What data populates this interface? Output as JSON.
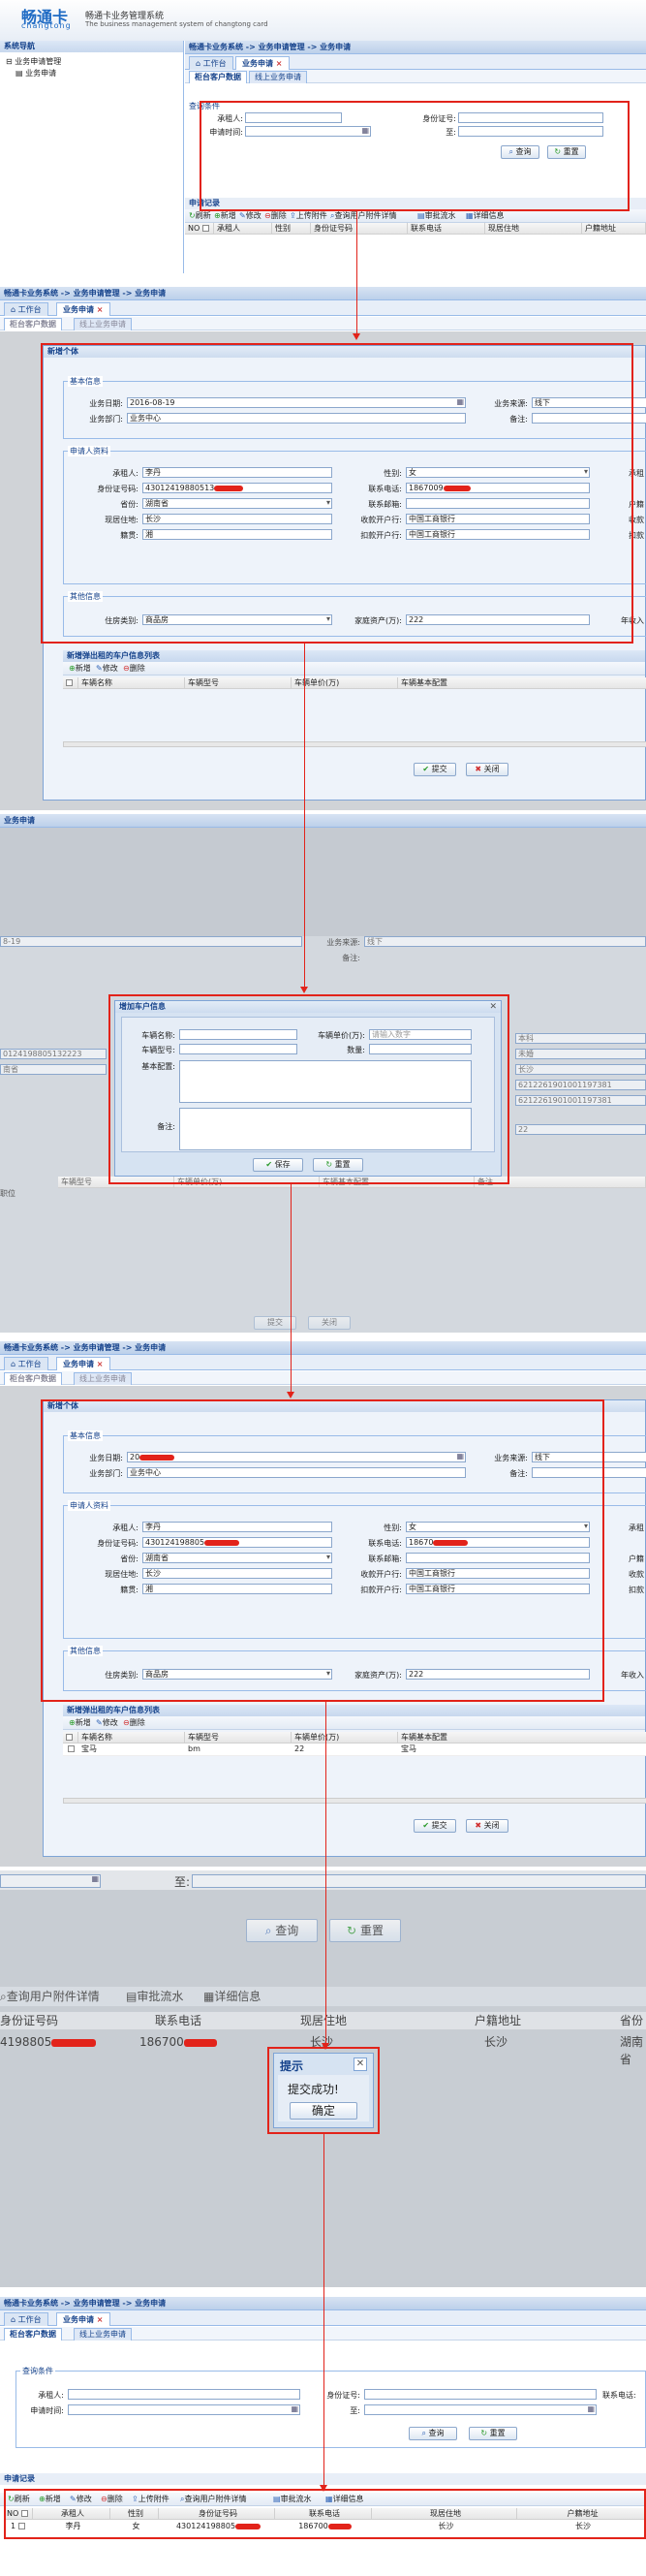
{
  "app": {
    "logo": "畅通卡",
    "logo_en": "changtong",
    "system_title": "畅通卡业务管理系统",
    "system_en": "The business management system of changtong card"
  },
  "nav": {
    "title": "系统导航",
    "group": "业务申请管理",
    "item": "业务申请"
  },
  "breadcrumb": "畅通卡业务系统 -> 业务申请管理 -> 业务申请",
  "breadcrumb_short": "业务申请",
  "tabs": {
    "workbench": "工作台",
    "apply": "业务申请",
    "close": "×"
  },
  "subtabs": {
    "counter": "柜台客户数据",
    "online": "线上业务申请"
  },
  "query": {
    "legend": "查询条件",
    "applicant": "承租人:",
    "idno": "身份证号:",
    "phone": "联系电话:",
    "apply_time": "申请时间:",
    "to": "至:",
    "search": "查询",
    "reset": "重置"
  },
  "records": {
    "title": "申请记录",
    "toolbar": [
      "刷新",
      "新增",
      "修改",
      "删除",
      "上传附件",
      "查询用户附件详情",
      "审批流水",
      "详细信息"
    ],
    "toolbar_short": [
      "查询用户附件详情",
      "审批流水",
      "详细信息"
    ],
    "columns": [
      "NO",
      "承租人",
      "性别",
      "身份证号码",
      "联系电话",
      "现居住地",
      "户籍地址"
    ],
    "columns_zoom": [
      "身份证号码",
      "联系电话",
      "现居住地",
      "户籍地址",
      "省份"
    ],
    "row": {
      "no": "1",
      "name": "李丹",
      "sex": "女",
      "id": "430124198805",
      "phone": "186700",
      "addr": "长沙",
      "reg": "长沙",
      "prov": "湖南省"
    },
    "zoom_row": {
      "id": "4198805",
      "phone": "186700",
      "addr": "长沙",
      "reg": "长沙",
      "prov": "湖南省"
    }
  },
  "form": {
    "title": "新增个体",
    "basic_legend": "基本信息",
    "biz_date_label": "业务日期:",
    "biz_date": "2016-08-19",
    "biz_date_masked": "20",
    "biz_source_label": "业务来源:",
    "biz_source": "线下",
    "dept_label": "业务部门:",
    "dept": "业务中心",
    "remark_label": "备注:",
    "applicant_legend": "申请人资料",
    "name_label": "承租人:",
    "name": "李丹",
    "sex_label": "性别:",
    "sex": "女",
    "id_label": "身份证号码:",
    "id": "43012419880513",
    "id_masked": "430124198805",
    "phone_label": "联系电话:",
    "phone": "1867009",
    "phone_masked": "18670",
    "prov_label": "省份:",
    "prov": "湖南省",
    "email_label": "联系邮箱:",
    "addr_label": "现居住地:",
    "addr": "长沙",
    "bank_label": "收款开户行:",
    "bank": "中国工商银行",
    "origin_label": "籍贯:",
    "origin": "湘",
    "deduct_label": "扣款开户行:",
    "deduct": "中国工商银行",
    "other_legend": "其他信息",
    "house_label": "住房类别:",
    "house": "商品房",
    "assets_label": "家庭资产(万):",
    "assets": "222",
    "annual_label": "年收入",
    "right_cut": [
      "承租",
      "户籍",
      "收款",
      "扣款"
    ],
    "vehicle_title": "新增弹出租的车户信息列表",
    "vehicle_tb": [
      "新增",
      "修改",
      "删除"
    ],
    "vehicle_cols": [
      "车辆名称",
      "车辆型号",
      "车辆单价(万)",
      "车辆基本配置"
    ],
    "vehicle_row": {
      "name": "宝马",
      "model": "bm",
      "price": "22",
      "cfg": "宝马"
    },
    "submit": "提交",
    "close": "关闭"
  },
  "dialog": {
    "title": "增加车户信息",
    "name_label": "车辆名称:",
    "price_label": "车辆单价(万):",
    "price_ph": "请输入数字",
    "model_label": "车辆型号:",
    "qty_label": "数量:",
    "cfg_label": "基本配置:",
    "remark_label": "备注:",
    "save": "保存",
    "reset": "重置",
    "bg_source": "业务来源:",
    "bg_source_val": "线下",
    "bg_remark": "备注:",
    "bg_date": "8-19",
    "bg_id": "0124198805132223",
    "bg_prov": "南省",
    "bg_right": [
      "本科",
      "未婚",
      "长沙",
      "6212261901001197381",
      "6212261901001197381",
      "22"
    ],
    "bg_pos": "职位",
    "bg_cols": [
      "车辆型号",
      "车辆单价(万)",
      "车辆基本配置",
      "备注"
    ]
  },
  "toast": {
    "title": "提示",
    "message": "提交成功!",
    "ok": "确定"
  }
}
